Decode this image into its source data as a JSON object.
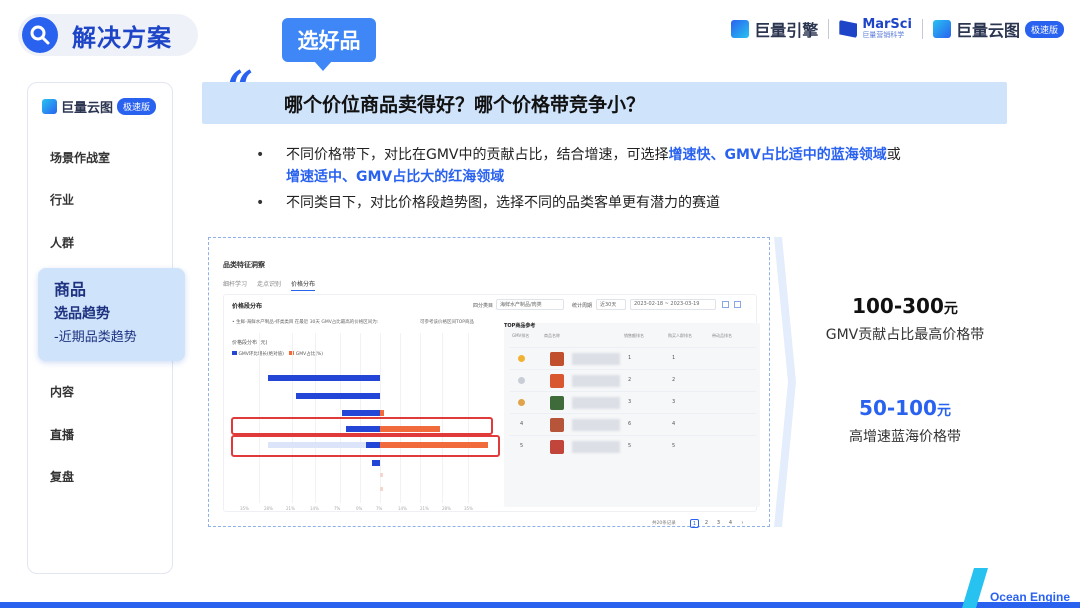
{
  "header": {
    "title": "解决方案",
    "scenario_tag": "选好品"
  },
  "logos": {
    "juliang_engine": "巨量引擎",
    "marsci": "MarSci",
    "marsci_sub": "巨量营销科学",
    "yuntu": "巨量云图",
    "yuntu_badge": "极速版"
  },
  "sidebar": {
    "brand": "巨量云图",
    "brand_badge": "极速版",
    "items": [
      "场景作战室",
      "行业",
      "人群",
      "内容",
      "直播",
      "复盘"
    ],
    "active": {
      "title": "商品",
      "sub1": "选品趋势",
      "sub2": "-近期品类趋势"
    }
  },
  "main": {
    "quote_mark": "“",
    "question": "哪个价位商品卖得好？哪个价格带竞争小？",
    "bullets": [
      {
        "before": "不同价格带下，对比在GMV中的贡献占比，结合增速，可选择",
        "highlight1": "增速快、GMV占比适中的蓝海领域",
        "middle": "或",
        "highlight2": "增速适中、GMV占比大的红海领域"
      },
      {
        "text": "不同类目下，对比价格段趋势图，选择不同的品类客单更有潜力的赛道"
      }
    ]
  },
  "dashboard": {
    "title": "品类特征洞察",
    "tabs": [
      "细杆学习",
      "走点识别",
      "价格分布"
    ],
    "panel_title": "价格段分布",
    "filter_category_label": "四分类目",
    "filter_category_value": "海鲜水产制品/肉类",
    "filter_period_label": "统计周期",
    "filter_period_value": "近30天",
    "filter_date_range": "2023-02-18 ~ 2023-03-19",
    "note": "• 生鲜-海鲜水产制品-虾类类目 在最近 30天 GMV占比最高的价格区间为:",
    "note_tail": "可参考该价格区间TOP商品",
    "chart_label": "价格段分布",
    "chart_unit": "(元)",
    "legend": [
      "GMV环比增长(绝对值)",
      "GMV占比(%)"
    ],
    "axis_ticks": [
      "35%",
      "28%",
      "21%",
      "14%",
      "7%",
      "0%",
      "7%",
      "14%",
      "21%",
      "28%",
      "35%"
    ],
    "table_title": "TOP商品参考",
    "table_headers": [
      "GMV排名",
      "商品名称",
      "销售额排名",
      "购买人群排名",
      "带动品排名"
    ],
    "table_rows": [
      {
        "rank": "1",
        "a": "1",
        "b": "1"
      },
      {
        "rank": "2",
        "a": "2",
        "b": "2"
      },
      {
        "rank": "3",
        "a": "3",
        "b": "3"
      },
      {
        "rank": "4",
        "a": "6",
        "b": "4"
      },
      {
        "rank": "5",
        "a": "5",
        "b": "5"
      }
    ],
    "pagination_total": "共20条记录",
    "pages": [
      "1",
      "2",
      "3",
      "4"
    ]
  },
  "stats": [
    {
      "value": "100-300",
      "unit": "元",
      "desc": "GMV贡献占比最高价格带",
      "color": "#111111"
    },
    {
      "value": "50-100",
      "unit": "元",
      "desc": "高增速蓝海价格带",
      "color": "#2a62f0"
    }
  ],
  "footer": {
    "brand": "Ocean Engine"
  },
  "colors": {
    "accent": "#2a62f0",
    "banner": "#cfe3fb",
    "bar_blue": "#2446d6",
    "bar_orange": "#f06a3c",
    "highlight_box": "#e03a3a"
  }
}
